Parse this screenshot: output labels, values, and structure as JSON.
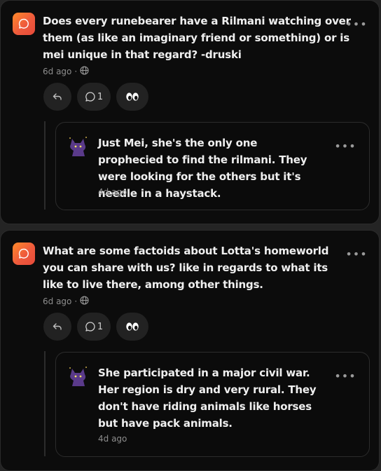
{
  "posts": [
    {
      "question": "Does every runebearer have a Rilmani watching over them (as like an imaginary friend or something) or is mei unique in that regard? -druski",
      "time": "6d ago",
      "comment_count": "1",
      "reply": {
        "text": "Just Mei, she's the only one prophecied to find the rilmani. They were looking for the others but it's needle in a haystack.",
        "time": "4d ago"
      }
    },
    {
      "question": "What are some factoids about Lotta's homeworld you can share with us? like in regards to what its like to live there, among other things.",
      "time": "6d ago",
      "comment_count": "1",
      "reply": {
        "text": "She participated in a major civil war. Her region is dry and very rural. They don't have riding animals like horses but have pack animals.",
        "time": "4d ago"
      }
    }
  ],
  "meta_separator": "·",
  "more_glyph": "•••",
  "colors": {
    "accent_gradient_start": "#ff8a2a",
    "accent_gradient_end": "#e64a3a",
    "card_bg": "#0c0c0c",
    "page_bg": "#242424"
  },
  "icons": [
    "chat-bubble-icon",
    "globe-icon",
    "reply-arrow-icon",
    "comment-icon",
    "eyes-icon",
    "more-dots-icon",
    "avatar-icon"
  ]
}
